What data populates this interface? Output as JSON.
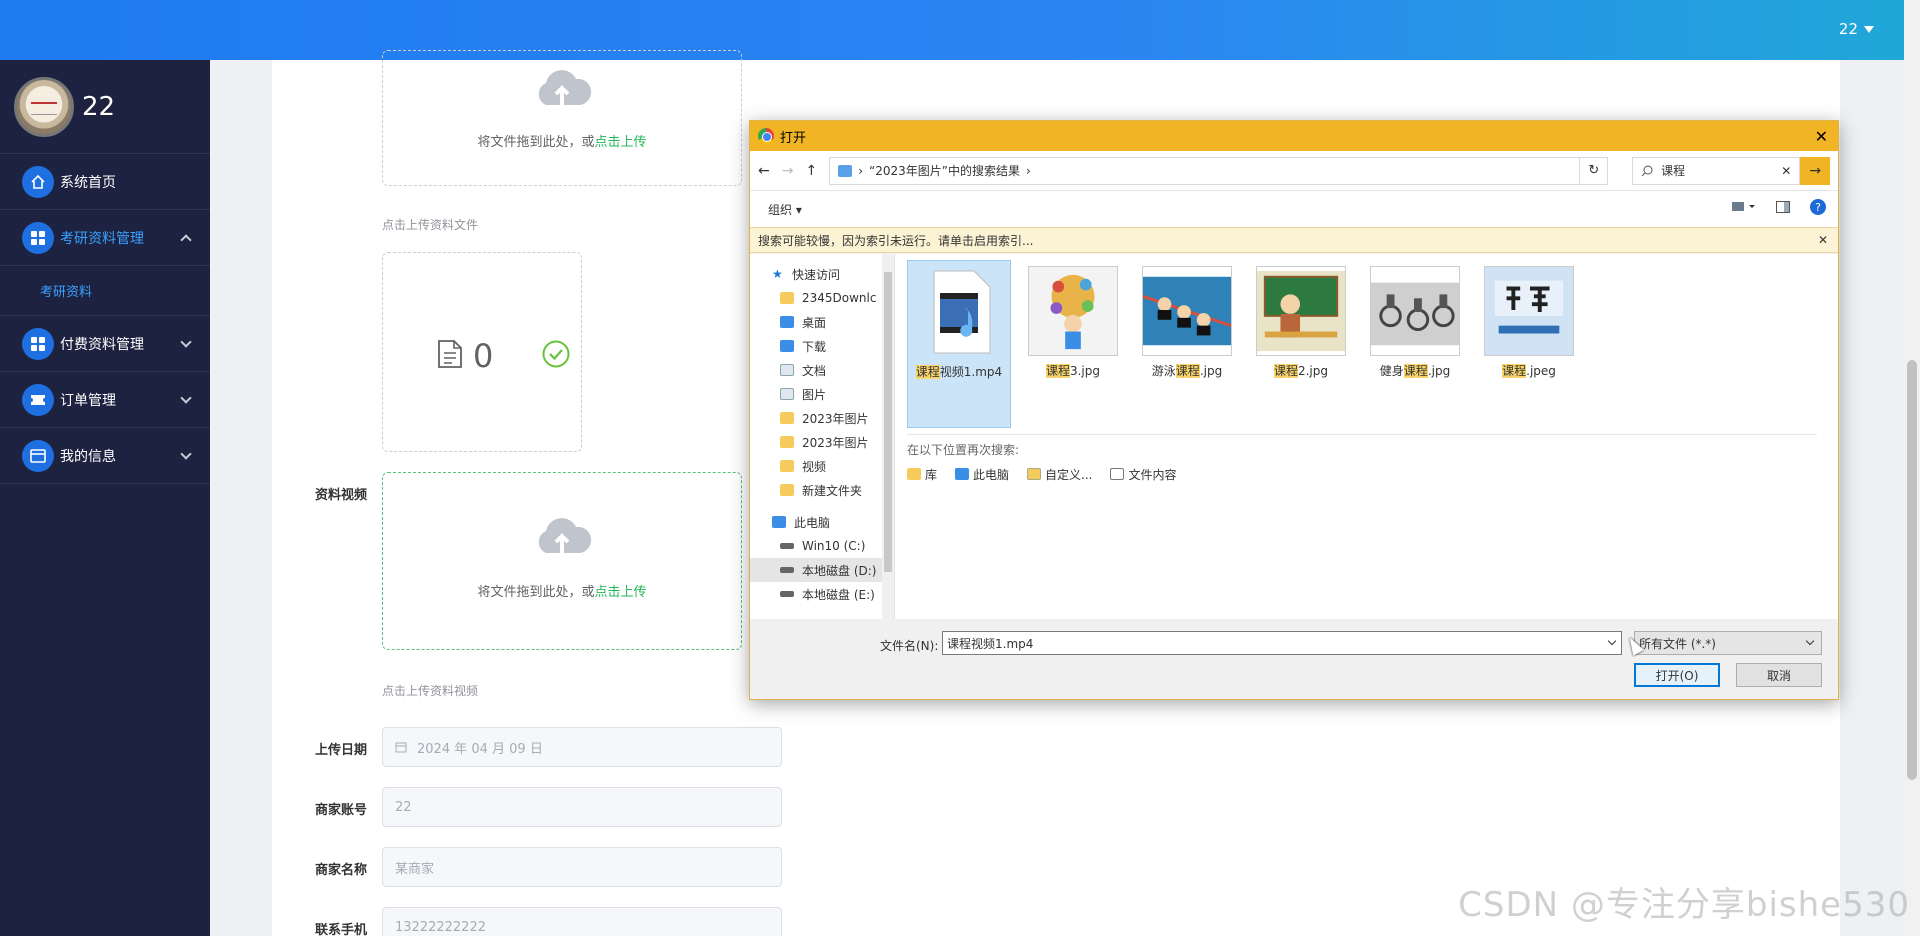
{
  "topbar": {
    "user": "22"
  },
  "sidebar": {
    "brand_name": "22",
    "items": [
      {
        "label": "系统首页",
        "icon": "home-icon"
      },
      {
        "label": "考研资料管理",
        "icon": "grid-icon",
        "expanded": true,
        "children": [
          {
            "label": "考研资料"
          }
        ]
      },
      {
        "label": "付费资料管理",
        "icon": "grid-icon"
      },
      {
        "label": "订单管理",
        "icon": "ticket-icon"
      },
      {
        "label": "我的信息",
        "icon": "card-icon"
      }
    ]
  },
  "form": {
    "upload1_hint_prefix": "将文件拖到此处，或",
    "upload1_hint_link": "点击上传",
    "upload1_tip": "点击上传资料文件",
    "file_count": "0",
    "video_label": "资料视频",
    "upload2_hint_prefix": "将文件拖到此处，或",
    "upload2_hint_link": "点击上传",
    "upload2_tip": "点击上传资料视频",
    "date_label": "上传日期",
    "date_value": "2024 年 04 月 09 日",
    "account_label": "商家账号",
    "account_value": "22",
    "name_label": "商家名称",
    "name_value": "某商家",
    "phone_label": "联系手机",
    "phone_value": "13222222222"
  },
  "dialog": {
    "title": "打开",
    "close": "✕",
    "back": "←",
    "forward": "→",
    "up": "↑",
    "breadcrumb": "“2023年图片”中的搜索结果",
    "refresh": "↻",
    "search_value": "课程",
    "search_clear": "✕",
    "search_go": "→",
    "organize": "组织 ▾",
    "help": "?",
    "infobar": "搜索可能较慢，因为索引未运行。请单击启用索引...",
    "infobar_close": "✕",
    "nav": [
      {
        "label": "快速访问",
        "icon": "star-icon",
        "top": true
      },
      {
        "label": "2345Downlc",
        "icon": "folder-icon",
        "pinned": true
      },
      {
        "label": "桌面",
        "icon": "desktop-icon",
        "pinned": true
      },
      {
        "label": "下载",
        "icon": "download-icon",
        "pinned": true
      },
      {
        "label": "文档",
        "icon": "document-icon",
        "pinned": true
      },
      {
        "label": "图片",
        "icon": "pictures-icon",
        "pinned": true
      },
      {
        "label": "2023年图片",
        "icon": "folder-icon"
      },
      {
        "label": "2023年图片",
        "icon": "folder-icon"
      },
      {
        "label": "视频",
        "icon": "folder-icon"
      },
      {
        "label": "新建文件夹",
        "icon": "folder-icon"
      },
      {
        "label": "此电脑",
        "icon": "computer-icon",
        "top": true
      },
      {
        "label": "Win10 (C:)",
        "icon": "drive-icon"
      },
      {
        "label": "本地磁盘 (D:)",
        "icon": "drive-icon",
        "selected": true
      },
      {
        "label": "本地磁盘 (E:)",
        "icon": "drive-icon"
      }
    ],
    "files": [
      {
        "pre": "",
        "hl": "课程",
        "post": "视频1.mp4",
        "selected": true
      },
      {
        "pre": "",
        "hl": "课程",
        "post": "3.jpg"
      },
      {
        "pre": "游泳",
        "hl": "课程",
        "post": ".jpg"
      },
      {
        "pre": "",
        "hl": "课程",
        "post": "2.jpg"
      },
      {
        "pre": "健身",
        "hl": "课程",
        "post": ".jpg"
      },
      {
        "pre": "",
        "hl": "课程",
        "post": ".jpeg"
      }
    ],
    "search_again_label": "在以下位置再次搜索:",
    "search_again_opts": [
      "库",
      "此电脑",
      "自定义...",
      "文件内容"
    ],
    "filename_label": "文件名(N):",
    "filename_value": "课程视频1.mp4",
    "filetype_value": "所有文件 (*.*)",
    "open_button": "打开(O)",
    "cancel_button": "取消"
  },
  "watermark": "CSDN @专注分享bishe530"
}
